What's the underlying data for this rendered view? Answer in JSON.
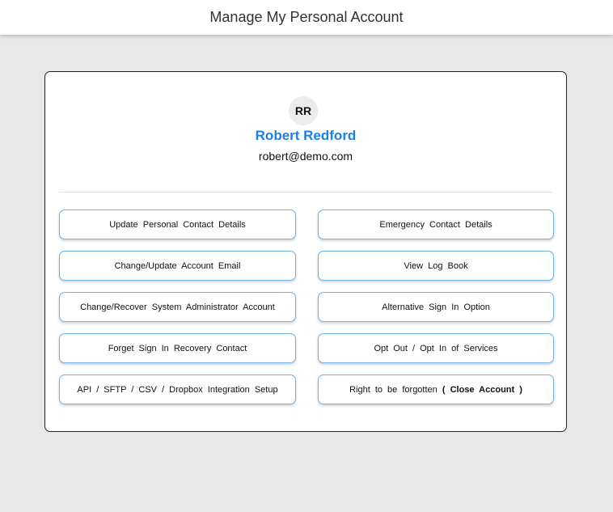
{
  "header": {
    "title": "Manage My Personal Account"
  },
  "profile": {
    "initials": "RR",
    "name": "Robert Redford",
    "email": "robert@demo.com",
    "name_color": "#1b7fe6"
  },
  "actions": [
    {
      "label": "Update Personal Contact Details"
    },
    {
      "label": "Emergency Contact Details"
    },
    {
      "label": "Change/Update Account Email"
    },
    {
      "label": "View Log Book"
    },
    {
      "label": "Change/Recover System Administrator Account"
    },
    {
      "label": "Alternative Sign In Option"
    },
    {
      "label": "Forget Sign In Recovery Contact"
    },
    {
      "label": "Opt Out / Opt In of Services"
    },
    {
      "label": "API / SFTP / CSV / Dropbox Integration Setup"
    },
    {
      "label": "Right to be forgotten",
      "emphasis": "( Close Account )"
    }
  ]
}
